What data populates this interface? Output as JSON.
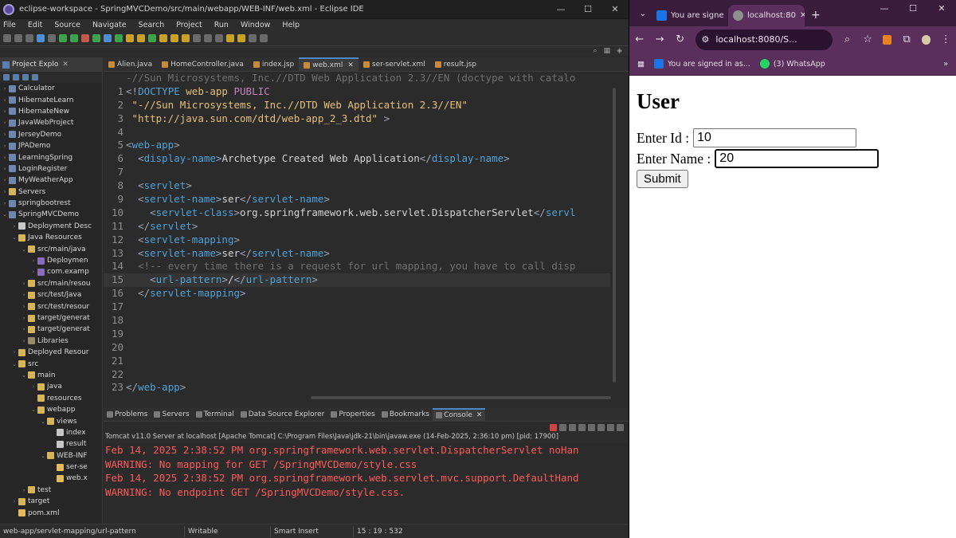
{
  "eclipse": {
    "title": "eclipse-workspace - SpringMVCDemo/src/main/webapp/WEB-INF/web.xml - Eclipse IDE",
    "window_controls": [
      "—",
      "☐",
      "✕"
    ],
    "menu": [
      "File",
      "Edit",
      "Source",
      "Navigate",
      "Search",
      "Project",
      "Run",
      "Window",
      "Help"
    ],
    "explorer": {
      "tab_label": "Project Explo",
      "items": [
        {
          "label": "Calculator",
          "depth": 0,
          "arrow": "›",
          "icon": "proj"
        },
        {
          "label": "HibernateLearn",
          "depth": 0,
          "arrow": "›",
          "icon": "proj"
        },
        {
          "label": "HibernateNew",
          "depth": 0,
          "arrow": "›",
          "icon": "proj"
        },
        {
          "label": "JavaWebProject",
          "depth": 0,
          "arrow": "›",
          "icon": "proj"
        },
        {
          "label": "JerseyDemo",
          "depth": 0,
          "arrow": "›",
          "icon": "proj"
        },
        {
          "label": "JPADemo",
          "depth": 0,
          "arrow": "›",
          "icon": "proj"
        },
        {
          "label": "LearningSpring",
          "depth": 0,
          "arrow": "›",
          "icon": "proj"
        },
        {
          "label": "LoginRegister",
          "depth": 0,
          "arrow": "›",
          "icon": "proj"
        },
        {
          "label": "MyWeatherApp",
          "depth": 0,
          "arrow": "›",
          "icon": "proj"
        },
        {
          "label": "Servers",
          "depth": 0,
          "arrow": "›",
          "icon": "fold"
        },
        {
          "label": "springbootrest",
          "depth": 0,
          "arrow": "›",
          "icon": "proj"
        },
        {
          "label": "SpringMVCDemo",
          "depth": 0,
          "arrow": "⌄",
          "icon": "proj"
        },
        {
          "label": "Deployment Desc",
          "depth": 1,
          "arrow": "›",
          "icon": "file"
        },
        {
          "label": "Java Resources",
          "depth": 1,
          "arrow": "⌄",
          "icon": "fold"
        },
        {
          "label": "src/main/java",
          "depth": 2,
          "arrow": "⌄",
          "icon": "fold"
        },
        {
          "label": "Deploymen",
          "depth": 3,
          "arrow": "›",
          "icon": "pkg"
        },
        {
          "label": "com.examp",
          "depth": 3,
          "arrow": "›",
          "icon": "pkg"
        },
        {
          "label": "src/main/resou",
          "depth": 2,
          "arrow": "›",
          "icon": "fold"
        },
        {
          "label": "src/test/java",
          "depth": 2,
          "arrow": "›",
          "icon": "fold"
        },
        {
          "label": "src/test/resour",
          "depth": 2,
          "arrow": "›",
          "icon": "fold"
        },
        {
          "label": "target/generat",
          "depth": 2,
          "arrow": "›",
          "icon": "fold"
        },
        {
          "label": "target/generat",
          "depth": 2,
          "arrow": "›",
          "icon": "fold"
        },
        {
          "label": "Libraries",
          "depth": 2,
          "arrow": "›",
          "icon": "lib"
        },
        {
          "label": "Deployed Resour",
          "depth": 1,
          "arrow": "›",
          "icon": "fold"
        },
        {
          "label": "src",
          "depth": 1,
          "arrow": "⌄",
          "icon": "fold"
        },
        {
          "label": "main",
          "depth": 2,
          "arrow": "⌄",
          "icon": "fold"
        },
        {
          "label": "java",
          "depth": 3,
          "arrow": "›",
          "icon": "fold"
        },
        {
          "label": "resources",
          "depth": 3,
          "arrow": "",
          "icon": "fold"
        },
        {
          "label": "webapp",
          "depth": 3,
          "arrow": "⌄",
          "icon": "fold"
        },
        {
          "label": "views",
          "depth": 4,
          "arrow": "⌄",
          "icon": "fold"
        },
        {
          "label": "index",
          "depth": 5,
          "arrow": "",
          "icon": "file"
        },
        {
          "label": "result",
          "depth": 5,
          "arrow": "",
          "icon": "file"
        },
        {
          "label": "WEB-INF",
          "depth": 4,
          "arrow": "⌄",
          "icon": "fold"
        },
        {
          "label": "ser-se",
          "depth": 5,
          "arrow": "",
          "icon": "xml"
        },
        {
          "label": "web.x",
          "depth": 5,
          "arrow": "",
          "icon": "xml"
        },
        {
          "label": "test",
          "depth": 2,
          "arrow": "›",
          "icon": "fold"
        },
        {
          "label": "target",
          "depth": 1,
          "arrow": "›",
          "icon": "fold"
        },
        {
          "label": "pom.xml",
          "depth": 1,
          "arrow": "",
          "icon": "xml"
        }
      ]
    },
    "editor_tabs": [
      {
        "label": "Alien.java",
        "active": false
      },
      {
        "label": "HomeController.java",
        "active": false
      },
      {
        "label": "index.jsp",
        "active": false
      },
      {
        "label": "web.xml",
        "active": true
      },
      {
        "label": "ser-servlet.xml",
        "active": false
      },
      {
        "label": "result.jsp",
        "active": false
      }
    ],
    "code": {
      "top_line": "-//Sun Microsystems, Inc.//DTD Web Application 2.3//EN (doctype with catalo",
      "lines": [
        {
          "n": "1",
          "html": "<span class='br'>&lt;!</span><span class='tg'>DOCTYPE</span> <span class='str'>web-app</span> <span class='kw'>PUBLIC</span>"
        },
        {
          "n": "2",
          "html": " <span class='str'>\"-//Sun Microsystems, Inc.//DTD Web Application 2.3//EN\"</span>"
        },
        {
          "n": "3",
          "html": " <span class='str'>\"http://java.sun.com/dtd/web-app_2_3.dtd\"</span> <span class='br'>&gt;</span>"
        },
        {
          "n": "4",
          "html": ""
        },
        {
          "n": "5",
          "html": "<span class='br'>&lt;</span><span class='tg'>web-app</span><span class='br'>&gt;</span>"
        },
        {
          "n": "6",
          "html": "  <span class='br'>&lt;</span><span class='tg'>display-name</span><span class='br'>&gt;</span>Archetype Created Web Application<span class='br'>&lt;/</span><span class='tg'>display-name</span><span class='br'>&gt;</span>"
        },
        {
          "n": "7",
          "html": ""
        },
        {
          "n": "8",
          "html": "  <span class='br'>&lt;</span><span class='tg'>servlet</span><span class='br'>&gt;</span>"
        },
        {
          "n": "9",
          "html": "  <span class='br'>&lt;</span><span class='tg'>servlet-name</span><span class='br'>&gt;</span>ser<span class='br'>&lt;/</span><span class='tg'>servlet-name</span><span class='br'>&gt;</span>"
        },
        {
          "n": "10",
          "html": "    <span class='br'>&lt;</span><span class='tg'>servlet-class</span><span class='br'>&gt;</span>org.springframework.web.servlet.DispatcherServlet<span class='br'>&lt;/</span><span class='tg'>servl</span>"
        },
        {
          "n": "11",
          "html": "  <span class='br'>&lt;/</span><span class='tg'>servlet</span><span class='br'>&gt;</span>"
        },
        {
          "n": "12",
          "html": "  <span class='br'>&lt;</span><span class='tg'>servlet-mapping</span><span class='br'>&gt;</span>"
        },
        {
          "n": "13",
          "html": "  <span class='br'>&lt;</span><span class='tg'>servlet-name</span><span class='br'>&gt;</span>ser<span class='br'>&lt;/</span><span class='tg'>servlet-name</span><span class='br'>&gt;</span>"
        },
        {
          "n": "14",
          "html": "  <span class='cm'>&lt;!-- every time there is a request for url mapping, you have to call disp</span>"
        },
        {
          "n": "15",
          "html": "    <span class='br'>&lt;</span><span class='tg'>url-pattern</span><span class='br'>&gt;</span>/<span class='br'>&lt;/</span><span class='tg'>url-pattern</span><span class='br'>&gt;</span>"
        },
        {
          "n": "16",
          "html": "  <span class='br'>&lt;/</span><span class='tg'>servlet-mapping</span><span class='br'>&gt;</span>"
        },
        {
          "n": "17",
          "html": ""
        },
        {
          "n": "18",
          "html": ""
        },
        {
          "n": "19",
          "html": ""
        },
        {
          "n": "20",
          "html": ""
        },
        {
          "n": "21",
          "html": ""
        },
        {
          "n": "22",
          "html": ""
        },
        {
          "n": "23",
          "html": "<span class='br'>&lt;/</span><span class='tg'>web-app</span><span class='br'>&gt;</span>"
        }
      ],
      "highlighted_line": "15"
    },
    "console": {
      "tabs": [
        {
          "label": "Problems",
          "active": false
        },
        {
          "label": "Servers",
          "active": false
        },
        {
          "label": "Terminal",
          "active": false
        },
        {
          "label": "Data Source Explorer",
          "active": false
        },
        {
          "label": "Properties",
          "active": false
        },
        {
          "label": "Bookmarks",
          "active": false
        },
        {
          "label": "Console",
          "active": true
        }
      ],
      "info": "Tomcat v11.0 Server at localhost [Apache Tomcat] C:\\Program Files\\Java\\jdk-21\\bin\\javaw.exe  (14-Feb-2025, 2:36:10 pm) [pid: 17900]",
      "log": [
        "Feb 14, 2025 2:38:52 PM org.springframework.web.servlet.DispatcherServlet noHan",
        "WARNING: No mapping for GET /SpringMVCDemo/style.css",
        "Feb 14, 2025 2:38:52 PM org.springframework.web.servlet.mvc.support.DefaultHand",
        "WARNING: No endpoint GET /SpringMVCDemo/style.css."
      ]
    },
    "status": {
      "path": "web-app/servlet-mapping/url-pattern",
      "mode": "Writable",
      "insert": "Smart Insert",
      "position": "15 : 19 : 532"
    }
  },
  "chrome": {
    "tabs": [
      {
        "label": "You are signe",
        "active": false,
        "favicon_color": "#1a73e8"
      },
      {
        "label": "localhost:80",
        "active": true,
        "favicon_color": "#8f8f8f"
      }
    ],
    "new_tab": "+",
    "window_controls": [
      "—",
      "☐",
      "✕"
    ],
    "url": "localhost:8080/S...",
    "bookmarks": [
      {
        "label": "You are signed in as...",
        "icon_color": "#1a73e8"
      },
      {
        "label": "(3) WhatsApp",
        "icon_color": "#25d366"
      }
    ],
    "page": {
      "heading": "User",
      "id_label": "Enter Id :",
      "id_value": "10",
      "name_label": "Enter Name :",
      "name_value": "20",
      "submit_label": "Submit"
    }
  }
}
